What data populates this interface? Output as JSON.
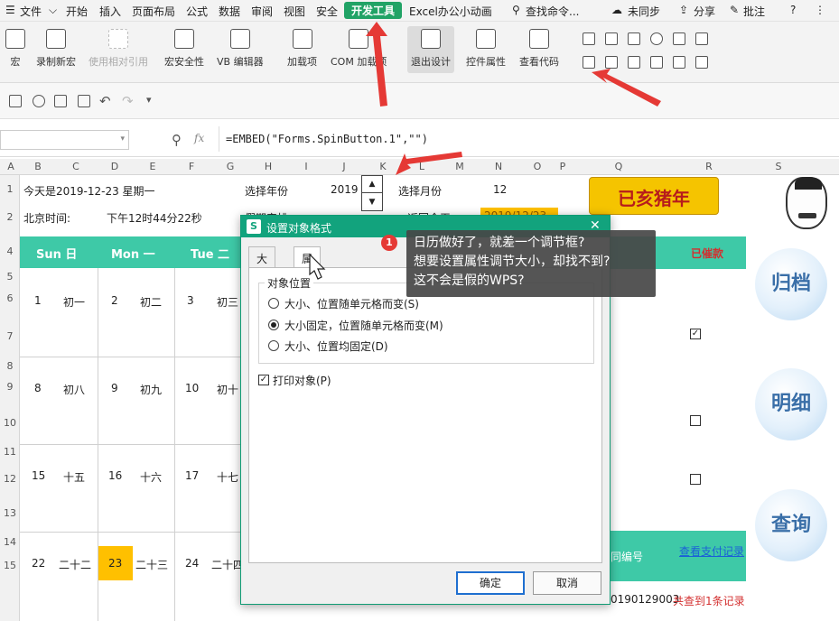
{
  "menu": {
    "file": "文件",
    "items": [
      "开始",
      "插入",
      "页面布局",
      "公式",
      "数据",
      "审阅",
      "视图",
      "安全"
    ],
    "active": "开发工具",
    "excel_anim": "Excel办公小动画",
    "search": "查找命令...",
    "sync": "未同步",
    "share": "分享",
    "comment": "批注"
  },
  "ribbon": {
    "macro": "宏",
    "record": "录制新宏",
    "relative": "使用相对引用",
    "security": "宏安全性",
    "vb": "VB 编辑器",
    "addin": "加载项",
    "com": "COM 加载项",
    "exit_design": "退出设计",
    "control_props": "控件属性",
    "view_code": "查看代码"
  },
  "formula_bar": {
    "fx": "fx",
    "formula": "=EMBED(\"Forms.SpinButton.1\",\"\")"
  },
  "columns": [
    "A",
    "B",
    "C",
    "D",
    "E",
    "F",
    "G",
    "H",
    "I",
    "J",
    "K",
    "L",
    "M",
    "N",
    "O",
    "P",
    "Q",
    "R",
    "S"
  ],
  "rows": [
    "1",
    "2",
    "4",
    "5",
    "6",
    "7",
    "8",
    "9",
    "10",
    "11",
    "12",
    "13",
    "14",
    "15"
  ],
  "sheet": {
    "today": "今天是2019-12-23 星期一",
    "select_year": "选择年份",
    "year": "2019",
    "select_month": "选择月份",
    "month": "12",
    "beijing_time": "北京时间:",
    "time": "下午12时44分22秒",
    "holiday": "假期安排",
    "back_today": "返回今天",
    "date_cell": "2019/12/23",
    "banner": "已亥猪年",
    "cuikuan": "已催款",
    "contract_no": "同编号",
    "check_pay": "查看支付记录",
    "contract_code": "0190129003",
    "found": "共查到1条记录"
  },
  "calendar": {
    "header": [
      "Sun 日",
      "Mon 一",
      "Tue 二"
    ],
    "week1": [
      "1",
      "初一",
      "2",
      "初二",
      "3",
      "初三"
    ],
    "week2": [
      "8",
      "初八",
      "9",
      "初九",
      "10",
      "初十"
    ],
    "week3": [
      "15",
      "十五",
      "16",
      "十六",
      "17",
      "十七"
    ],
    "week4": [
      "22",
      "二十二",
      "23",
      "二十三",
      "24",
      "二十四"
    ]
  },
  "side_buttons": {
    "archive": "归档",
    "detail": "明细",
    "query": "查询"
  },
  "dialog": {
    "title": "设置对象格式",
    "tab_size": "大小",
    "tab_props": "属性",
    "group_label": "对象位置",
    "opt1": "大小、位置随单元格而变(S)",
    "opt2": "大小固定，位置随单元格而变(M)",
    "opt3": "大小、位置均固定(D)",
    "print": "打印对象(P)",
    "ok": "确定",
    "cancel": "取消"
  },
  "tooltip": {
    "badge": "1",
    "line1": "日历做好了，就差一个调节框?",
    "line2": "想要设置属性调节大小，却找不到?",
    "line3": "这不会是假的WPS?"
  },
  "colors": {
    "accent_green": "#3ec9a7",
    "ribbon_active": "#21a366",
    "arrow_red": "#e53935",
    "today_highlight": "#ffc000"
  }
}
